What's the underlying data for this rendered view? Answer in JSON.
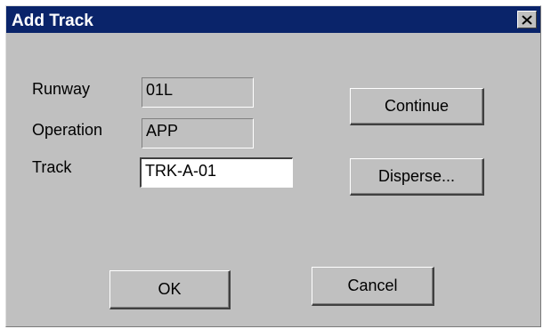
{
  "window": {
    "title": "Add Track"
  },
  "icons": {
    "close": "close-icon"
  },
  "fields": {
    "runway": {
      "label": "Runway",
      "value": "01L"
    },
    "operation": {
      "label": "Operation",
      "value": "APP"
    },
    "track": {
      "label": "Track",
      "value": "TRK-A-01"
    }
  },
  "buttons": {
    "continue": "Continue",
    "disperse": "Disperse...",
    "ok": "OK",
    "cancel": "Cancel"
  },
  "colors": {
    "titlebar": "#0a246a",
    "dialog_face": "#c0c0c0"
  }
}
